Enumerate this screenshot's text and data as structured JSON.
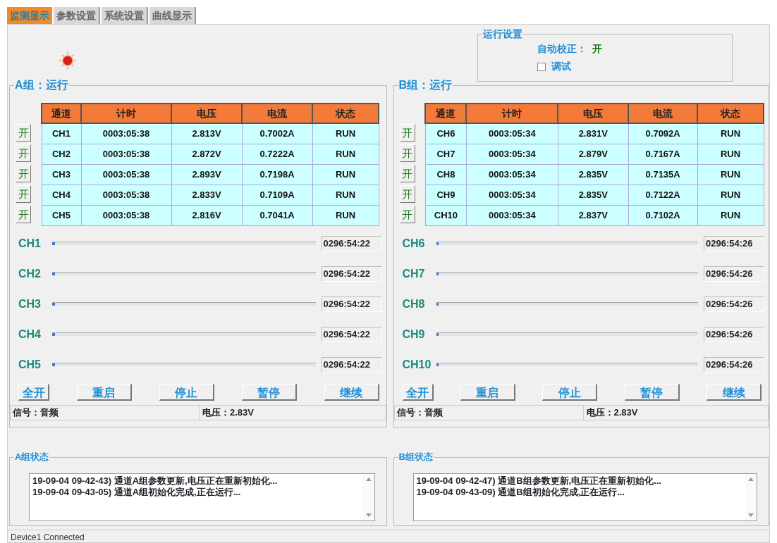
{
  "tabs": [
    {
      "label": "监测显示",
      "selected": true
    },
    {
      "label": "参数设置",
      "selected": false
    },
    {
      "label": "系统设置",
      "selected": false
    },
    {
      "label": "曲线显示",
      "selected": false
    }
  ],
  "run_settings": {
    "title": "运行设置",
    "auto_calibration": {
      "label": "自动校正：",
      "value": "开"
    },
    "debug": {
      "label": "调试",
      "checked": false
    }
  },
  "groups": [
    {
      "title": "A组：运行",
      "columns": [
        "通道",
        "计时",
        "电压",
        "电流",
        "状态"
      ],
      "rows": [
        {
          "switch": "开",
          "cells": [
            "CH1",
            "0003:05:38",
            "2.813V",
            "0.7002A",
            "RUN"
          ]
        },
        {
          "switch": "开",
          "cells": [
            "CH2",
            "0003:05:38",
            "2.872V",
            "0.7222A",
            "RUN"
          ]
        },
        {
          "switch": "开",
          "cells": [
            "CH3",
            "0003:05:38",
            "2.893V",
            "0.7198A",
            "RUN"
          ]
        },
        {
          "switch": "开",
          "cells": [
            "CH4",
            "0003:05:38",
            "2.833V",
            "0.7109A",
            "RUN"
          ]
        },
        {
          "switch": "开",
          "cells": [
            "CH5",
            "0003:05:38",
            "2.816V",
            "0.7041A",
            "RUN"
          ]
        }
      ],
      "progress": [
        {
          "label": "CH1",
          "level": 0.01,
          "reading": "0296:54:22"
        },
        {
          "label": "CH2",
          "level": 0.01,
          "reading": "0296:54:22"
        },
        {
          "label": "CH3",
          "level": 0.01,
          "reading": "0296:54:22"
        },
        {
          "label": "CH4",
          "level": 0.01,
          "reading": "0296:54:22"
        },
        {
          "label": "CH5",
          "level": 0.01,
          "reading": "0296:54:22"
        }
      ],
      "buttons": [
        "全开",
        "重启",
        "停止",
        "暂停",
        "继续"
      ],
      "signal": "信号：音频",
      "voltage": "电压：2.83V"
    },
    {
      "title": "B组：运行",
      "columns": [
        "通道",
        "计时",
        "电压",
        "电流",
        "状态"
      ],
      "rows": [
        {
          "switch": "开",
          "cells": [
            "CH6",
            "0003:05:34",
            "2.831V",
            "0.7092A",
            "RUN"
          ]
        },
        {
          "switch": "开",
          "cells": [
            "CH7",
            "0003:05:34",
            "2.879V",
            "0.7167A",
            "RUN"
          ]
        },
        {
          "switch": "开",
          "cells": [
            "CH8",
            "0003:05:34",
            "2.835V",
            "0.7135A",
            "RUN"
          ]
        },
        {
          "switch": "开",
          "cells": [
            "CH9",
            "0003:05:34",
            "2.835V",
            "0.7122A",
            "RUN"
          ]
        },
        {
          "switch": "开",
          "cells": [
            "CH10",
            "0003:05:34",
            "2.837V",
            "0.7102A",
            "RUN"
          ]
        }
      ],
      "progress": [
        {
          "label": "CH6",
          "level": 0.01,
          "reading": "0296:54:26"
        },
        {
          "label": "CH7",
          "level": 0.01,
          "reading": "0296:54:26"
        },
        {
          "label": "CH8",
          "level": 0.01,
          "reading": "0296:54:26"
        },
        {
          "label": "CH9",
          "level": 0.01,
          "reading": "0296:54:26"
        },
        {
          "label": "CH10",
          "level": 0.01,
          "reading": "0296:54:26"
        }
      ],
      "buttons": [
        "全开",
        "重启",
        "停止",
        "暂停",
        "继续"
      ],
      "signal": "信号：音频",
      "voltage": "电压：2.83V"
    }
  ],
  "logs": [
    {
      "title": "A组状态",
      "lines": [
        "19-09-04  09-42-43) 通道A组参数更新,电压正在重新初始化...",
        "19-09-04  09-43-05) 通道A组初始化完成,正在运行..."
      ]
    },
    {
      "title": "B组状态",
      "lines": [
        "19-09-04  09-42-47) 通道B组参数更新,电压正在重新初始化...",
        "19-09-04  09-43-09) 通道B组初始化完成,正在运行..."
      ]
    }
  ],
  "status_bar": "Device1 Connected"
}
